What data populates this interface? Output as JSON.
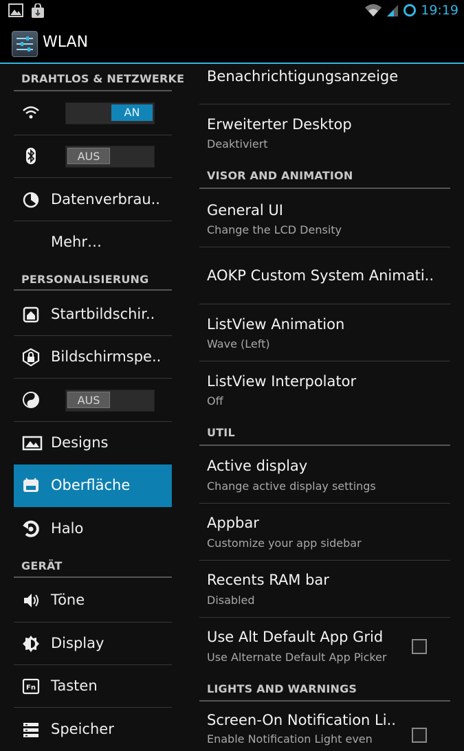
{
  "status_bar": {
    "time": "19:19"
  },
  "action_bar": {
    "title": "WLAN"
  },
  "left_nav": {
    "section_wireless": "DRAHTLOS & NETZWERKE",
    "wifi_toggle": "AN",
    "bluetooth_toggle": "AUS",
    "data_usage": "Datenverbrau..",
    "more": "Mehr…",
    "section_personal": "PERSONALISIERUNG",
    "homescreen": "Startbildschir..",
    "lockscreen": "Bildschirmspe..",
    "theme_toggle": "AUS",
    "designs": "Designs",
    "interface": "Oberfläche",
    "halo": "Halo",
    "section_device": "GERÄT",
    "sound": "Töne",
    "display": "Display",
    "buttons": "Tasten",
    "storage": "Speicher"
  },
  "settings": {
    "notif_display": "Benachrichtigungsanzeige",
    "expanded_desktop": {
      "title": "Erweiterter Desktop",
      "summary": "Deaktiviert"
    },
    "section_visor": "VISOR AND ANIMATION",
    "general_ui": {
      "title": "General UI",
      "summary": "Change the LCD Density"
    },
    "aokp_anim": "AOKP Custom System Animati..",
    "listview_anim": {
      "title": "ListView Animation",
      "summary": "Wave (Left)"
    },
    "listview_interp": {
      "title": "ListView Interpolator",
      "summary": "Off"
    },
    "section_util": "UTIL",
    "active_display": {
      "title": "Active display",
      "summary": "Change active display settings"
    },
    "appbar": {
      "title": "Appbar",
      "summary": "Customize your app sidebar"
    },
    "recents_ram": {
      "title": "Recents RAM bar",
      "summary": "Disabled"
    },
    "alt_app_grid": {
      "title": "Use Alt Default App Grid",
      "summary": "Use Alternate Default App Picker",
      "checked": false
    },
    "section_lights": "LIGHTS AND WARNINGS",
    "screen_on_notif": {
      "title": "Screen-On Notification Li..",
      "summary": "Enable Notification Light even",
      "checked": false
    }
  },
  "colors": {
    "accent": "#33b5e5",
    "selected": "#0d7fb0",
    "background": "#101010"
  }
}
